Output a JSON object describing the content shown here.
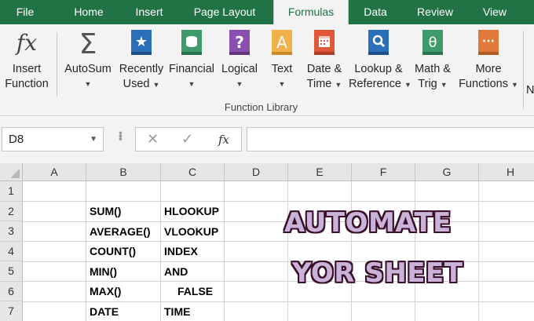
{
  "tabs": [
    "File",
    "Home",
    "Insert",
    "Page Layout",
    "Formulas",
    "Data",
    "Review",
    "View"
  ],
  "active_tab": "Formulas",
  "ribbon": {
    "insert_function": {
      "line1": "Insert",
      "line2": "Function"
    },
    "autosum": {
      "line1": "AutoSum"
    },
    "recently_used": {
      "line1": "Recently",
      "line2": "Used"
    },
    "financial": {
      "line1": "Financial"
    },
    "logical": {
      "line1": "Logical"
    },
    "text": {
      "line1": "Text"
    },
    "date_time": {
      "line1": "Date &",
      "line2": "Time"
    },
    "lookup_reference": {
      "line1": "Lookup &",
      "line2": "Reference"
    },
    "math_trig": {
      "line1": "Math &",
      "line2": "Trig"
    },
    "more_functions": {
      "line1": "More",
      "line2": "Functions"
    },
    "group_label": "Function Library",
    "cut_label": "N"
  },
  "formula_bar": {
    "name_box": "D8",
    "fx": "fx",
    "content": ""
  },
  "columns": [
    "A",
    "B",
    "C",
    "D",
    "E",
    "F",
    "G",
    "H"
  ],
  "rows": [
    "1",
    "2",
    "3",
    "4",
    "5",
    "6",
    "7"
  ],
  "cells": {
    "B2": "SUM()",
    "C2": "HLOOKUP",
    "B3": "AVERAGE()",
    "C3": "VLOOKUP",
    "B4": "COUNT()",
    "C4": "INDEX",
    "B5": "MIN()",
    "C5": "AND",
    "B6": "MAX()",
    "C6": "FALSE",
    "B7": "DATE",
    "C7": "TIME"
  },
  "overlay": {
    "line1": "AUTOMATE",
    "line2": "YOR SHEET"
  },
  "colors": {
    "excel_green": "#217346",
    "overlay_fill": "#c9b3d9",
    "overlay_outline": "#3a0f29"
  }
}
